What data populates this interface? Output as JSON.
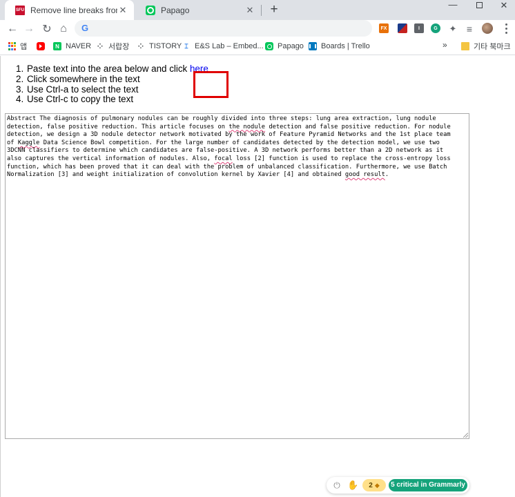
{
  "browser": {
    "tabs": [
      {
        "title": "Remove line breaks from text",
        "favicon": "SFU",
        "active": true
      },
      {
        "title": "Papago",
        "active": false
      }
    ],
    "new_tab_label": "+",
    "window_controls": {
      "minimize": "—",
      "close": "✕"
    }
  },
  "toolbar": {
    "back": "←",
    "forward": "→",
    "reload": "↻",
    "home": "⌂",
    "omnibox_logo": "G",
    "omnibox_value": "",
    "extensions": [
      {
        "name": "fx-extension",
        "label": "FX",
        "color": "#e8710a"
      },
      {
        "name": "flag-extension",
        "label": "",
        "color": "#c5221f"
      },
      {
        "name": "dark-extension",
        "label": "I",
        "color": "#5f6368"
      },
      {
        "name": "grammarly-extension",
        "label": "G",
        "color": "#15a37b"
      }
    ],
    "puzzle": "✦",
    "queue": "≡"
  },
  "bookmarks": {
    "items": [
      {
        "name": "apps",
        "label": "앱"
      },
      {
        "name": "youtube",
        "label": ""
      },
      {
        "name": "naver",
        "label": "NAVER",
        "badge": "N"
      },
      {
        "name": "seorapjang",
        "label": "서랍장"
      },
      {
        "name": "tistory",
        "label": "TISTORY"
      },
      {
        "name": "es-lab",
        "label": "E&S Lab – Embed..."
      },
      {
        "name": "papago",
        "label": "Papago"
      },
      {
        "name": "trello",
        "label": "Boards | Trello"
      }
    ],
    "overflow": "»",
    "other_folder": "기타 북마크"
  },
  "page": {
    "steps": [
      {
        "num": "1.",
        "text": "Paste text into the area below and click ",
        "link": "here"
      },
      {
        "num": "2.",
        "text": "Click somewhere in the text"
      },
      {
        "num": "3.",
        "text": "Use Ctrl-a to select the text"
      },
      {
        "num": "4.",
        "text": "Use Ctrl-c to copy the text"
      }
    ],
    "textarea_lines": [
      "Abstract The diagnosis of pulmonary nodules can be roughly divided into three steps: lung area extraction, lung nodule",
      "detection, false positive reduction. This article focuses on ",
      "the nodule",
      " detection and false positive reduction. For nodule",
      "detection, we design a 3D nodule detector network motivated by the work of Feature Pyramid Networks and the 1st place team",
      "of ",
      "Kaggle",
      " Data Science Bowl competition. For the large number of candidates detected by the detection model, we use two",
      "3DCNN classifiers to determine which candidates are false-positive. A 3D network performs better than a 2D network as it",
      "also captures the vertical information of nodules. Also, ",
      "focal",
      " loss [2] function is used to replace the cross-entropy loss",
      "function, which has been proved that it can deal with the problem of unbalanced classification. Furthermore, we use Batch",
      "Normalization [3] and weight initialization of convolution kernel by Xavier [4] and obtained ",
      "good result",
      "."
    ],
    "grammarly": {
      "premium_count": "2",
      "critical_label": "5 critical in Grammarly",
      "accent": "#15a37b",
      "premium_color": "#ffe08a"
    }
  }
}
